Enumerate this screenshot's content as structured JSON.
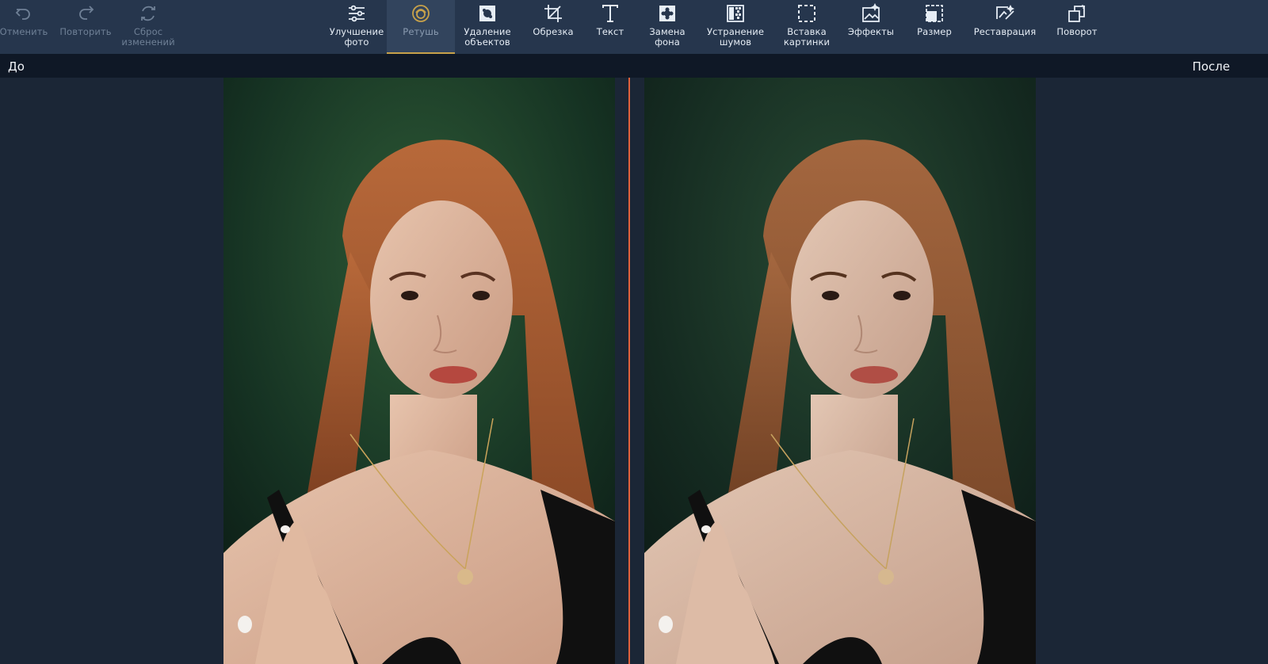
{
  "toolbar": {
    "history": [
      {
        "label": "Отменить",
        "icon": "undo-icon"
      },
      {
        "label": "Повторить",
        "icon": "redo-icon"
      },
      {
        "label": "Сброс\nизменений",
        "icon": "reset-icon"
      }
    ],
    "tools": [
      {
        "label": "Улучшение\nфото",
        "icon": "sliders-icon"
      },
      {
        "label": "Ретушь",
        "icon": "retouch-face-icon",
        "active": true
      },
      {
        "label": "Удаление\nобъектов",
        "icon": "object-removal-icon"
      },
      {
        "label": "Обрезка",
        "icon": "crop-icon"
      },
      {
        "label": "Текст",
        "icon": "text-icon"
      },
      {
        "label": "Замена\nфона",
        "icon": "background-replace-icon"
      },
      {
        "label": "Устранение\nшумов",
        "icon": "denoise-icon"
      },
      {
        "label": "Вставка\nкартинки",
        "icon": "insert-picture-icon"
      },
      {
        "label": "Эффекты",
        "icon": "effects-icon"
      },
      {
        "label": "Размер",
        "icon": "resize-icon"
      },
      {
        "label": "Реставрация",
        "icon": "restoration-icon"
      },
      {
        "label": "Поворот",
        "icon": "rotate-icon"
      }
    ]
  },
  "compare": {
    "before_label": "До",
    "after_label": "После"
  },
  "colors": {
    "toolbar_bg": "#26364d",
    "label_bar_bg": "#0f1826",
    "canvas_bg": "#1b2636",
    "accent": "#c8a24a",
    "divider": "#e0613c"
  }
}
